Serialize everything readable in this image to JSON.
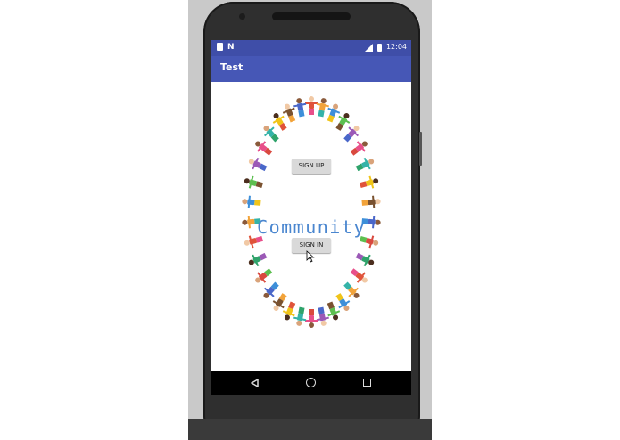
{
  "status_bar": {
    "notification_icons": [
      "sd-card-icon",
      "n-icon"
    ],
    "time": "12:04"
  },
  "app_bar": {
    "title": "Test"
  },
  "content": {
    "logo_text": "Community",
    "sign_up_label": "SIGN UP",
    "sign_in_label": "SIGN IN"
  },
  "nav_bar": {
    "icons": [
      "back-icon",
      "home-icon",
      "recents-icon"
    ]
  },
  "colors": {
    "status_bar": "#3f4ea8",
    "app_bar": "#4657b6",
    "logo_text": "#4a86cf",
    "button": "#d9d9d9"
  }
}
